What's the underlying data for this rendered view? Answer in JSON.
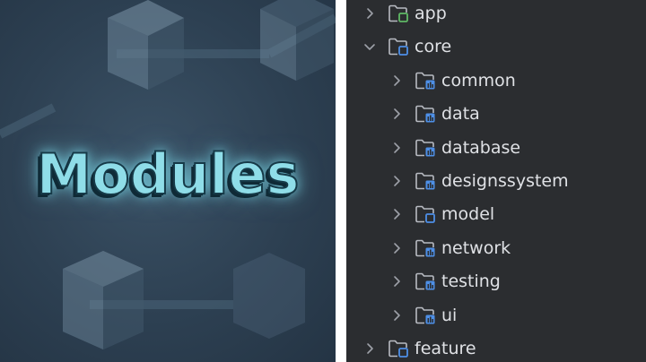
{
  "banner": {
    "title": "Modules"
  },
  "project_tree": {
    "items": [
      {
        "label": "app",
        "level": 0,
        "expanded": false,
        "badge": "green-square"
      },
      {
        "label": "core",
        "level": 0,
        "expanded": true,
        "badge": "blue-square"
      },
      {
        "label": "common",
        "level": 1,
        "expanded": false,
        "badge": "blue-library"
      },
      {
        "label": "data",
        "level": 1,
        "expanded": false,
        "badge": "blue-library"
      },
      {
        "label": "database",
        "level": 1,
        "expanded": false,
        "badge": "blue-library"
      },
      {
        "label": "designssystem",
        "level": 1,
        "expanded": false,
        "badge": "blue-library"
      },
      {
        "label": "model",
        "level": 1,
        "expanded": false,
        "badge": "blue-square"
      },
      {
        "label": "network",
        "level": 1,
        "expanded": false,
        "badge": "blue-library"
      },
      {
        "label": "testing",
        "level": 1,
        "expanded": false,
        "badge": "blue-library"
      },
      {
        "label": "ui",
        "level": 1,
        "expanded": false,
        "badge": "blue-library"
      },
      {
        "label": "feature",
        "level": 0,
        "expanded": false,
        "badge": "blue-square"
      }
    ]
  },
  "colors": {
    "tree_background": "#2b2d30",
    "text": "#dfe1e5",
    "module_badge_green": "#5fb865",
    "module_badge_blue": "#4e8fe6",
    "banner_title": "#8fdde8"
  }
}
